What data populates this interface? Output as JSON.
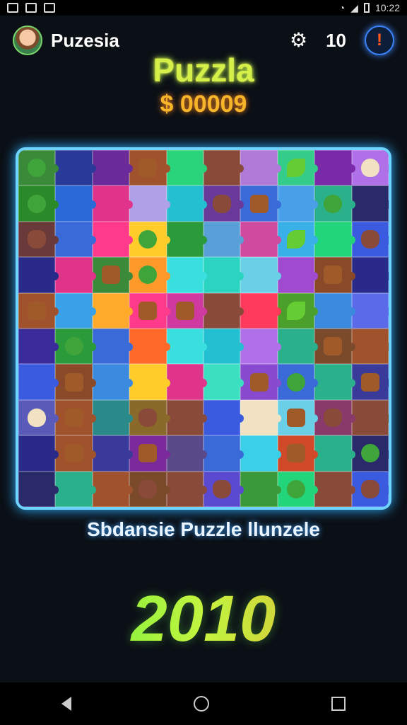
{
  "status_bar": {
    "time": "10:22"
  },
  "header": {
    "app_name": "Puzesia",
    "count": "10",
    "settings_icon": "gear-icon",
    "alert_icon": "exclamation-icon"
  },
  "game": {
    "title": "Puzzla",
    "money": "$ 00009",
    "subtitle": "Sbdansie Puzzle llunzele",
    "year": "2010"
  },
  "board": {
    "columns": 10,
    "rows": 10,
    "tile_colors": [
      "#3a8a3a",
      "#2a3a9a",
      "#6a2a9a",
      "#a0522d",
      "#2ad47a",
      "#8a4a3a",
      "#b07ad8",
      "#33cc88",
      "#7a2aa8",
      "#b070e8",
      "#2a8a2a",
      "#2a6ad8",
      "#e0338a",
      "#b0a0e8",
      "#22c0d0",
      "#6a3a9a",
      "#3a6ad8",
      "#4aa0e8",
      "#2ab08a",
      "#2a2a6a",
      "#6a3a3a",
      "#3a6ad8",
      "#ff3a8a",
      "#ffcc2a",
      "#2a9a3a",
      "#5aa0d8",
      "#d04aa0",
      "#3ab0e8",
      "#22d47a",
      "#3a5ae0",
      "#2a2a8a",
      "#e0338a",
      "#3a8a3a",
      "#ff9a2a",
      "#3ae0e0",
      "#2ad4c0",
      "#6ad0e8",
      "#a04ad0",
      "#8a4a2a",
      "#2a2a8a",
      "#a0522d",
      "#3aa0e8",
      "#ffaa2a",
      "#ff3a8a",
      "#d03aa0",
      "#8a4a3a",
      "#ff3a5a",
      "#4aa02a",
      "#3a8ae0",
      "#5a6ae8",
      "#3a2a9a",
      "#2a9a3a",
      "#3a6ad8",
      "#ff6a2a",
      "#3ae0e0",
      "#22c0d0",
      "#b070e8",
      "#2ab08a",
      "#7a4a2a",
      "#a0522d",
      "#3a5ae0",
      "#8a4a2a",
      "#3a8ae0",
      "#ffcc2a",
      "#e0338a",
      "#3ae0c0",
      "#8a4ad0",
      "#3a6ad8",
      "#2ab08a",
      "#3a3a9a",
      "#5a5ab8",
      "#a0522d",
      "#2a8a8a",
      "#8a6a2a",
      "#8a4a3a",
      "#3a5ae0",
      "#f2e2c4",
      "#6ad0e8",
      "#8a3a6a",
      "#8a4a3a",
      "#2a2a8a",
      "#a0522d",
      "#3a3a9a",
      "#7a2a9a",
      "#5a4a8a",
      "#3a6ad8",
      "#3ad0e8",
      "#d04a2a",
      "#2ab08a",
      "#2a2a6a",
      "#2a2a6a",
      "#2ab08a",
      "#a0522d",
      "#7a4a2a",
      "#8a4a3a",
      "#5a4ad0",
      "#3a9a3a",
      "#22d47a",
      "#8a4a3a",
      "#3a5ae0"
    ],
    "pieces": [
      "frog",
      "",
      "",
      "log",
      "",
      "bear",
      "",
      "leaf",
      "",
      "egg",
      "frog",
      "",
      "",
      "",
      "",
      "bear",
      "log",
      "",
      "frog",
      "",
      "bear",
      "",
      "",
      "frog",
      "",
      "",
      "",
      "leaf",
      "",
      "bear",
      "",
      "",
      "log",
      "frog",
      "",
      "",
      "",
      "",
      "log",
      "",
      "log",
      "",
      "",
      "log",
      "log",
      "bear",
      "",
      "leaf",
      "",
      "",
      "",
      "frog",
      "",
      "",
      "",
      "",
      "",
      "",
      "log",
      "",
      "",
      "log",
      "",
      "",
      "",
      "",
      "log",
      "frog",
      "",
      "log",
      "egg",
      "log",
      "",
      "bear",
      "bear",
      "",
      "egg",
      "log",
      "bear",
      "bear",
      "",
      "log",
      "",
      "log",
      "",
      "",
      "",
      "log",
      "",
      "frog",
      "",
      "",
      "",
      "bear",
      "",
      "bear",
      "",
      "frog",
      "",
      "bear"
    ]
  }
}
